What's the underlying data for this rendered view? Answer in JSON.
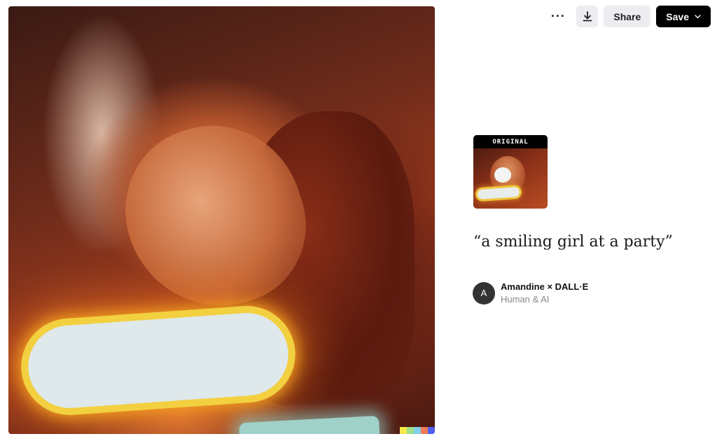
{
  "image": {
    "description_icon": "photo-image",
    "signature_colors": [
      "#f5e94a",
      "#9fe08a",
      "#7fd0e8",
      "#f07a5a",
      "#5060f0"
    ]
  },
  "toolbar": {
    "more_icon": "more-horizontal-icon",
    "more_glyph": "···",
    "download_icon": "download-icon",
    "share_label": "Share",
    "save_label": "Save",
    "save_chevron": "chevron-down-icon"
  },
  "original": {
    "label": "ORIGINAL"
  },
  "prompt": {
    "text": "“a smiling girl at a party”"
  },
  "author": {
    "avatar_initial": "A",
    "name": "Amandine × DALL·E",
    "subtitle": "Human & AI"
  },
  "colors": {
    "button_bg": "#ececf1",
    "save_bg": "#000000",
    "avatar_bg": "#333333"
  }
}
